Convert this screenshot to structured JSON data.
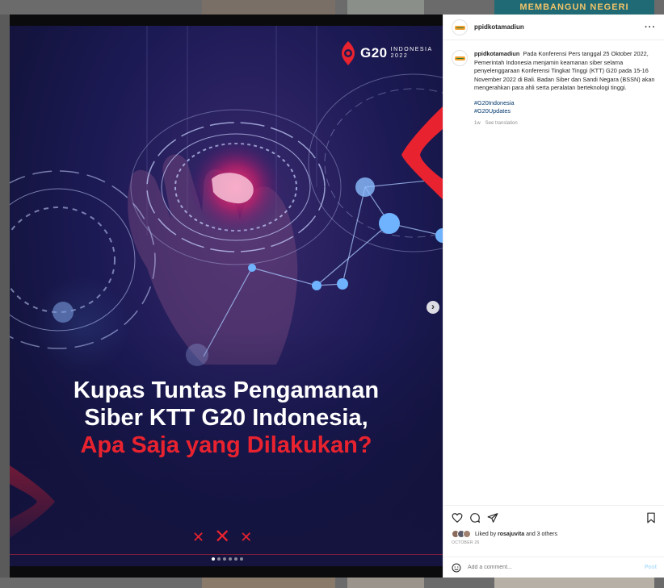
{
  "background": {
    "banner_text": "MEMBANGUN NEGERI"
  },
  "post": {
    "username": "ppidkotamadiun",
    "poster": {
      "brand": "G20",
      "brand_country": "INDONESIA",
      "brand_year": "2022",
      "headline_line1": "Kupas Tuntas Pengamanan",
      "headline_line2": "Siber KTT G20 Indonesia,",
      "headline_line3": "Apa Saja yang Dilakukan?"
    },
    "carousel": {
      "total_slides": 6,
      "current_slide": 1
    },
    "caption": {
      "username": "ppidkotamadiun",
      "text": "Pada Konferensi Pers tanggal 25 Oktober 2022, Pemerintah Indonesia menjamin keamanan siber selama penyelenggaraan Konferensi Tingkat Tinggi (KTT) G20 pada 15-16 November 2022 di Bali. Badan Siber dan Sandi Negara (BSSN) akan mengerahkan para ahli serta peralatan berteknologi tinggi.",
      "hashtags": [
        "#G20Indonesia",
        "#G20Updates"
      ],
      "age": "1w",
      "see_translation": "See translation"
    },
    "likes": {
      "prefix": "Liked by",
      "user": "rosajuvita",
      "suffix": "and 3 others"
    },
    "date": "OCTOBER 26",
    "comment": {
      "placeholder": "Add a comment...",
      "post_label": "Post"
    },
    "colors": {
      "accent_red": "#e8232f",
      "poster_bg": "#1c1a55",
      "link": "#00376b"
    }
  }
}
